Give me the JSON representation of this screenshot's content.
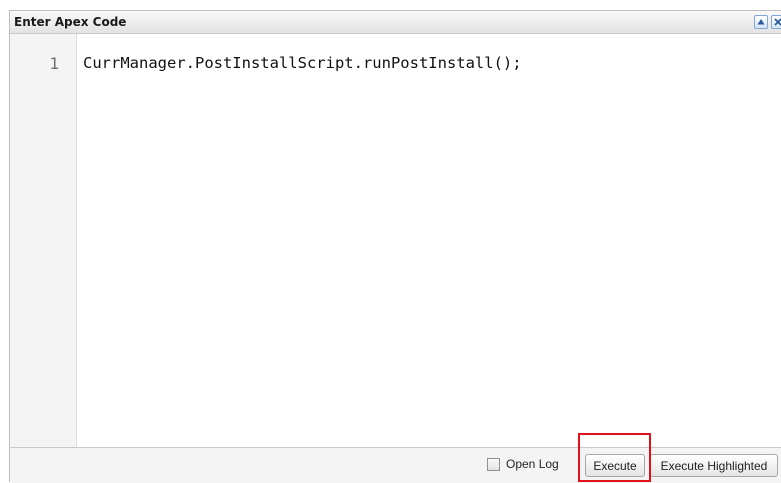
{
  "dialog": {
    "title": "Enter Apex Code",
    "buttons": {
      "collapse_icon": "arrow-up-icon",
      "close_icon": "close-icon"
    }
  },
  "editor": {
    "lines": [
      {
        "number": "1",
        "text": "CurrManager.PostInstallScript.runPostInstall();"
      }
    ]
  },
  "footer": {
    "open_log": {
      "label": "Open Log",
      "checked": false
    },
    "execute_label": "Execute",
    "execute_highlighted_label": "Execute Highlighted"
  },
  "annotation": {
    "color": "#e0101a",
    "target": "Execute"
  },
  "colors": {
    "accent": "#7fa6d6",
    "annotation": "#e0101a"
  }
}
